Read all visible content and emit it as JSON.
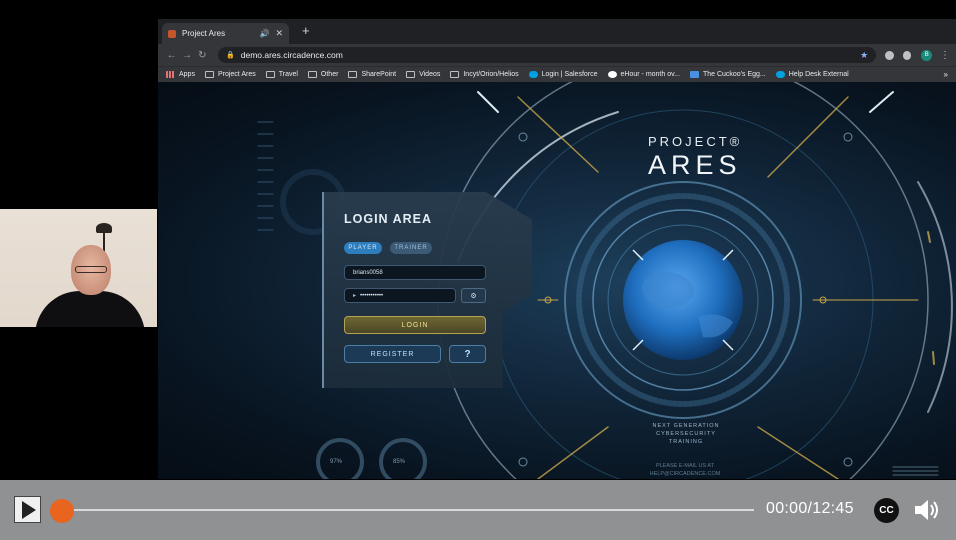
{
  "browser": {
    "tab": {
      "title": "Project Ares"
    },
    "url": "demo.ares.circadence.com",
    "bookmarks": [
      {
        "label": "Apps",
        "icon": "apps-icon"
      },
      {
        "label": "Project Ares",
        "icon": "folder-icon"
      },
      {
        "label": "Travel",
        "icon": "folder-icon"
      },
      {
        "label": "Other",
        "icon": "folder-icon"
      },
      {
        "label": "SharePoint",
        "icon": "folder-icon"
      },
      {
        "label": "Videos",
        "icon": "folder-icon"
      },
      {
        "label": "Incyt/Orion/Helios",
        "icon": "folder-icon"
      },
      {
        "label": "Login | Salesforce",
        "icon": "salesforce-icon"
      },
      {
        "label": "eHour - month ov...",
        "icon": "google-icon"
      },
      {
        "label": "The Cuckoo's Egg...",
        "icon": "bookmark-icon"
      },
      {
        "label": "Help Desk External",
        "icon": "salesforce-icon"
      }
    ],
    "profile_initial": "B"
  },
  "login": {
    "title": "LOGIN AREA",
    "role_player": "PLAYER",
    "role_trainer": "TRAINER",
    "username": "brians0058",
    "password_mask": "•••••••••••",
    "login_label": "LOGIN",
    "register_label": "REGISTER",
    "help_label": "?"
  },
  "brand": {
    "top": "PROJECT®",
    "main": "ARES",
    "tagline": "NEXT GENERATION CYBERSECURITY TRAINING",
    "contact": "PLEASE E-MAIL US AT HELP@CIRCADENCE.COM"
  },
  "gauges": {
    "left": "97%",
    "right": "85%"
  },
  "player": {
    "time": "00:00/12:45",
    "cc_label": "CC",
    "progress": 0
  }
}
